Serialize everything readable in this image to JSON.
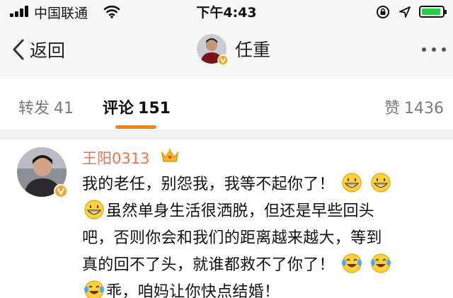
{
  "status_bar": {
    "carrier": "中国联通",
    "time": "下午4:43"
  },
  "nav": {
    "back_label": "返回",
    "user_name": "任重"
  },
  "tabs": {
    "repost": {
      "label": "转发",
      "count": "41"
    },
    "comment": {
      "label": "评论",
      "count": "151"
    },
    "like": {
      "label": "赞",
      "count": "1436"
    }
  },
  "comment": {
    "username": "王阳0313",
    "line1": "我的老任，别怨我，我等不起你了！",
    "line2a": "虽然单身生活很洒脱，但还是早些回头",
    "line2b": "吧，否则你会和我们的距离越来越大，等到",
    "line2c": "真的回不了头，就谁都救不了你了！",
    "line3": "乖，咱妈让你快点结婚！"
  },
  "colors": {
    "accent": "#ff8200",
    "username": "#eb7350",
    "battery": "#2ecc40",
    "verified": "#f5a623"
  },
  "icons": [
    "signal-icon",
    "wifi-icon",
    "rotation-lock-icon",
    "location-arrow-icon",
    "battery-icon",
    "back-chevron-icon",
    "more-icon",
    "verified-badge-icon",
    "crown-icon",
    "grin-emoji-icon",
    "laugh-tears-emoji-icon"
  ]
}
